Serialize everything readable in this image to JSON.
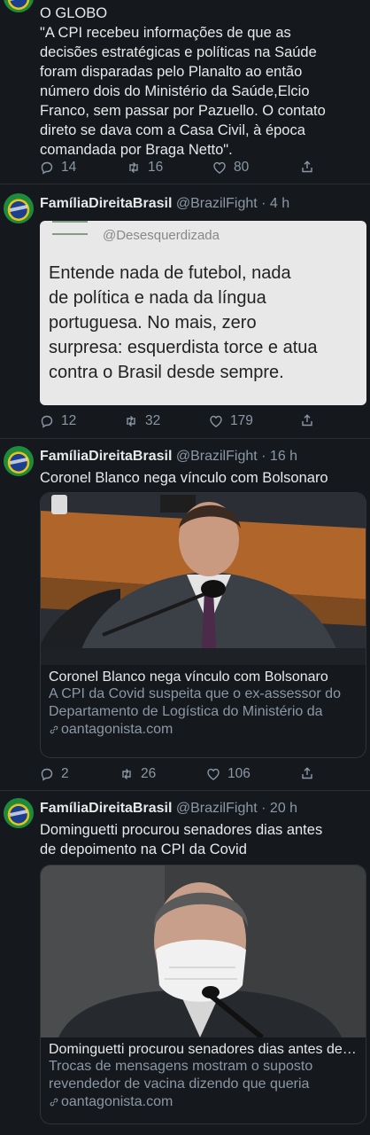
{
  "tweet1": {
    "text_lines": [
      "O GLOBO",
      "\"A CPI recebeu informações de que as",
      "decisões estratégicas e políticas na Saúde",
      "foram disparadas pelo Planalto ao então",
      "número dois do Ministério da Saúde,Elcio",
      "Franco, sem passar por Pazuello. O contato",
      "direto se dava com a Casa Civil, à época",
      "comandada por Braga Netto\"."
    ],
    "replies": "14",
    "retweets": "16",
    "likes": "80"
  },
  "tweet2": {
    "name": "FamíliaDireitaBrasil",
    "handle": "@BrazilFight",
    "time": "· 4 h",
    "quoted_handle": "@Desesquerdizada",
    "quoted_lines": [
      "Entende nada de futebol, nada",
      "de política e nada da língua",
      "portuguesa. No mais, zero",
      "surpresa: esquerdista torce e atua",
      "contra o Brasil desde sempre."
    ],
    "replies": "12",
    "retweets": "32",
    "likes": "179"
  },
  "tweet3": {
    "name": "FamíliaDireitaBrasil",
    "handle": "@BrazilFight",
    "time": "· 16 h",
    "text": "Coronel Blanco nega vínculo com Bolsonaro",
    "card_title": "Coronel Blanco nega vínculo com Bolsonaro",
    "card_desc": "A CPI da Covid suspeita que o ex-assessor do Departamento de Logística do Ministério da Saúde",
    "card_link": "oantagonista.com",
    "replies": "2",
    "retweets": "26",
    "likes": "106"
  },
  "tweet4": {
    "name": "FamíliaDireitaBrasil",
    "handle": "@BrazilFight",
    "time": "· 20 h",
    "text_lines": [
      "Dominguetti procurou senadores dias antes",
      "de depoimento na CPI da Covid"
    ],
    "card_title": "Dominguetti procurou senadores dias antes de depoimento na CPI da Covid",
    "card_desc": "Trocas de mensagens mostram o suposto revendedor de vacina dizendo que queria conversar",
    "card_link": "oantagonista.com"
  },
  "icons": {
    "reply": "reply-icon",
    "retweet": "retweet-icon",
    "like": "heart-icon",
    "share": "share-icon",
    "link": "link-icon"
  },
  "colors": {
    "background": "#15181c",
    "text": "#e7e9ea",
    "secondary": "#8b98a5",
    "border": "#2f3336"
  }
}
